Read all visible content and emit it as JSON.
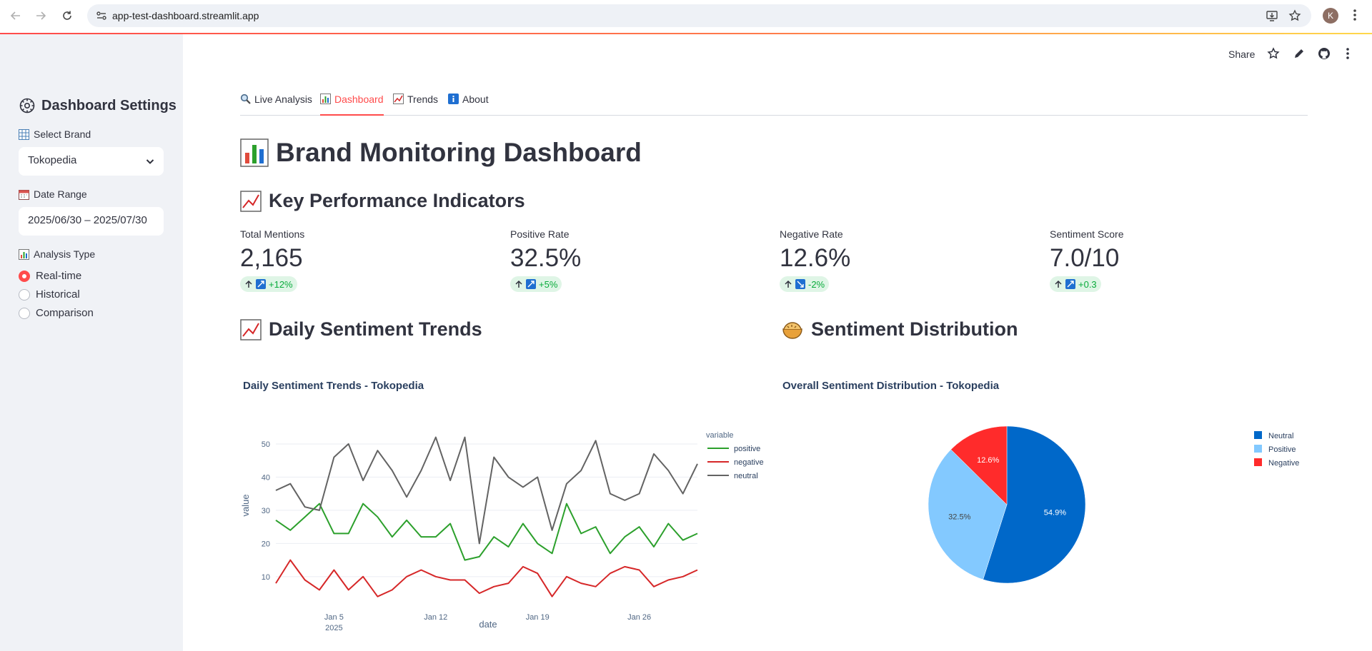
{
  "browser": {
    "url": "app-test-dashboard.streamlit.app",
    "profile_initial": "K"
  },
  "toolbar": {
    "share_label": "Share"
  },
  "sidebar": {
    "title": "Dashboard Settings",
    "brand_label": "Select Brand",
    "brand_value": "Tokopedia",
    "date_label": "Date Range",
    "date_value": "2025/06/30 – 2025/07/30",
    "analysis_label": "Analysis Type",
    "analysis_options": [
      "Real-time",
      "Historical",
      "Comparison"
    ],
    "analysis_selected": "Real-time"
  },
  "tabs": [
    {
      "label": "Live Analysis",
      "icon": "magnifier-icon"
    },
    {
      "label": "Dashboard",
      "icon": "bar-chart-icon",
      "active": true
    },
    {
      "label": "Trends",
      "icon": "trend-up-icon"
    },
    {
      "label": "About",
      "icon": "info-icon"
    }
  ],
  "page": {
    "title": "Brand Monitoring Dashboard",
    "kpi_heading": "Key Performance Indicators",
    "trends_heading": "Daily Sentiment Trends",
    "distribution_heading": "Sentiment Distribution"
  },
  "metrics": [
    {
      "label": "Total Mentions",
      "value": "2,165",
      "delta": "+12%",
      "trend": "up"
    },
    {
      "label": "Positive Rate",
      "value": "32.5%",
      "delta": "+5%",
      "trend": "up"
    },
    {
      "label": "Negative Rate",
      "value": "12.6%",
      "delta": "-2%",
      "trend": "down"
    },
    {
      "label": "Sentiment Score",
      "value": "7.0/10",
      "delta": "+0.3",
      "trend": "up"
    }
  ],
  "colors": {
    "accent": "#ff4b4b",
    "positive": "#2ca02c",
    "negative": "#d62728",
    "neutral": "#636363",
    "pie_neutral": "#0068c9",
    "pie_positive": "#83c9ff",
    "pie_negative": "#ff2b2b"
  },
  "chart_data": [
    {
      "type": "line",
      "title": "Daily Sentiment Trends - Tokopedia",
      "xlabel": "date",
      "ylabel": "value",
      "legend_title": "variable",
      "legend_position": "top-right",
      "x": [
        "2025-01-01",
        "2025-01-02",
        "2025-01-03",
        "2025-01-04",
        "2025-01-05",
        "2025-01-06",
        "2025-01-07",
        "2025-01-08",
        "2025-01-09",
        "2025-01-10",
        "2025-01-11",
        "2025-01-12",
        "2025-01-13",
        "2025-01-14",
        "2025-01-15",
        "2025-01-16",
        "2025-01-17",
        "2025-01-18",
        "2025-01-19",
        "2025-01-20",
        "2025-01-21",
        "2025-01-22",
        "2025-01-23",
        "2025-01-24",
        "2025-01-25",
        "2025-01-26",
        "2025-01-27",
        "2025-01-28",
        "2025-01-29",
        "2025-01-30"
      ],
      "x_ticks": [
        {
          "date": "2025-01-05",
          "label": "Jan 5",
          "sublabel": "2025"
        },
        {
          "date": "2025-01-12",
          "label": "Jan 12"
        },
        {
          "date": "2025-01-19",
          "label": "Jan 19"
        },
        {
          "date": "2025-01-26",
          "label": "Jan 26"
        }
      ],
      "y_ticks": [
        10,
        20,
        30,
        40,
        50
      ],
      "ylim": [
        2,
        53
      ],
      "grid": true,
      "series": [
        {
          "name": "positive",
          "values": [
            27,
            24,
            28,
            32,
            23,
            23,
            32,
            28,
            22,
            27,
            22,
            22,
            26,
            15,
            16,
            22,
            19,
            26,
            20,
            17,
            32,
            23,
            25,
            17,
            22,
            25,
            19,
            26,
            21,
            23
          ]
        },
        {
          "name": "negative",
          "values": [
            8,
            15,
            9,
            6,
            12,
            6,
            10,
            4,
            6,
            10,
            12,
            10,
            9,
            9,
            5,
            7,
            8,
            13,
            11,
            4,
            10,
            8,
            7,
            11,
            13,
            12,
            7,
            9,
            10,
            12
          ]
        },
        {
          "name": "neutral",
          "values": [
            36,
            38,
            31,
            30,
            46,
            50,
            39,
            48,
            42,
            34,
            42,
            52,
            39,
            52,
            20,
            46,
            40,
            37,
            40,
            24,
            38,
            42,
            51,
            35,
            33,
            35,
            47,
            42,
            35,
            44
          ]
        }
      ]
    },
    {
      "type": "pie",
      "title": "Overall Sentiment Distribution - Tokopedia",
      "legend_position": "top-right",
      "slices": [
        {
          "label": "Neutral",
          "value": 54.9,
          "display": "54.9%"
        },
        {
          "label": "Positive",
          "value": 32.5,
          "display": "32.5%"
        },
        {
          "label": "Negative",
          "value": 12.6,
          "display": "12.6%"
        }
      ]
    }
  ]
}
